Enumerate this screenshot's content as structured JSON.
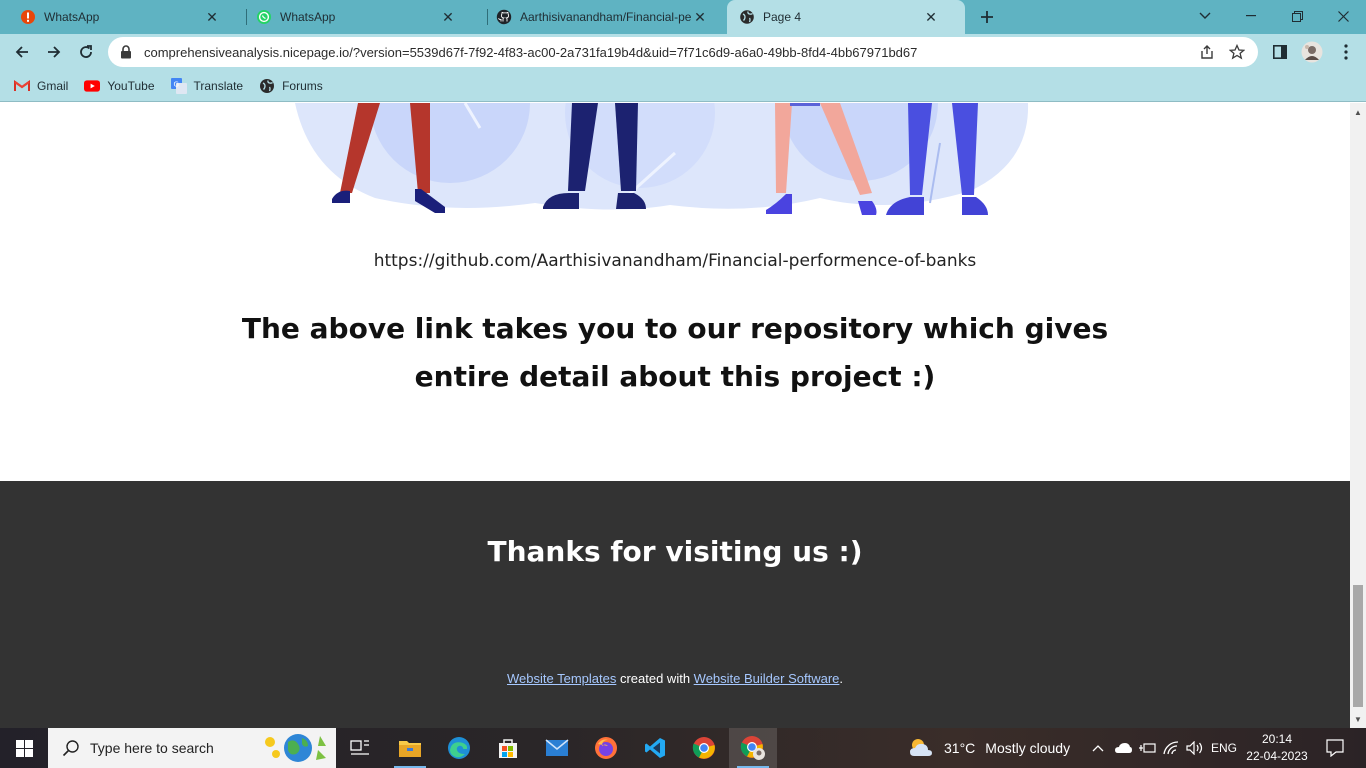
{
  "tabs": [
    {
      "title": "WhatsApp",
      "icon": "alert-icon"
    },
    {
      "title": "WhatsApp",
      "icon": "whatsapp-icon"
    },
    {
      "title": "Aarthisivanandham/Financial-performence-of-banks",
      "icon": "github-icon"
    },
    {
      "title": "Page 4",
      "icon": "globe-icon",
      "active": true
    }
  ],
  "address_bar": {
    "url": "comprehensiveanalysis.nicepage.io/?version=5539d67f-7f92-4f83-ac00-2a731fa19b4d&uid=7f71c6d9-a6a0-49bb-8fd4-4bb67971bd67"
  },
  "bookmarks": [
    {
      "label": "Gmail",
      "icon": "gmail-icon"
    },
    {
      "label": "YouTube",
      "icon": "youtube-icon"
    },
    {
      "label": "Translate",
      "icon": "translate-icon"
    },
    {
      "label": "Forums",
      "icon": "forums-icon"
    }
  ],
  "page": {
    "repo_link": "https://github.com/Aarthisivanandham/Financial-performence-of-banks",
    "heading": "The above link takes you to our repository which gives entire detail about this project :)",
    "footer": {
      "thanks": "Thanks for visiting us :)",
      "link1": "Website Templates",
      "middle_text": " created with ",
      "link2": "Website Builder Software",
      "end_text": "."
    }
  },
  "taskbar": {
    "search_placeholder": "Type here to search",
    "weather": {
      "temp": "31°C",
      "condition": "Mostly cloudy"
    },
    "language": "ENG",
    "time": "20:14",
    "date": "22-04-2023"
  },
  "colors": {
    "tabstrip": "#5fb3c2",
    "toolbar": "#b4dfe6",
    "footer_bg": "#333333",
    "footer_link": "#a6c8ff"
  }
}
